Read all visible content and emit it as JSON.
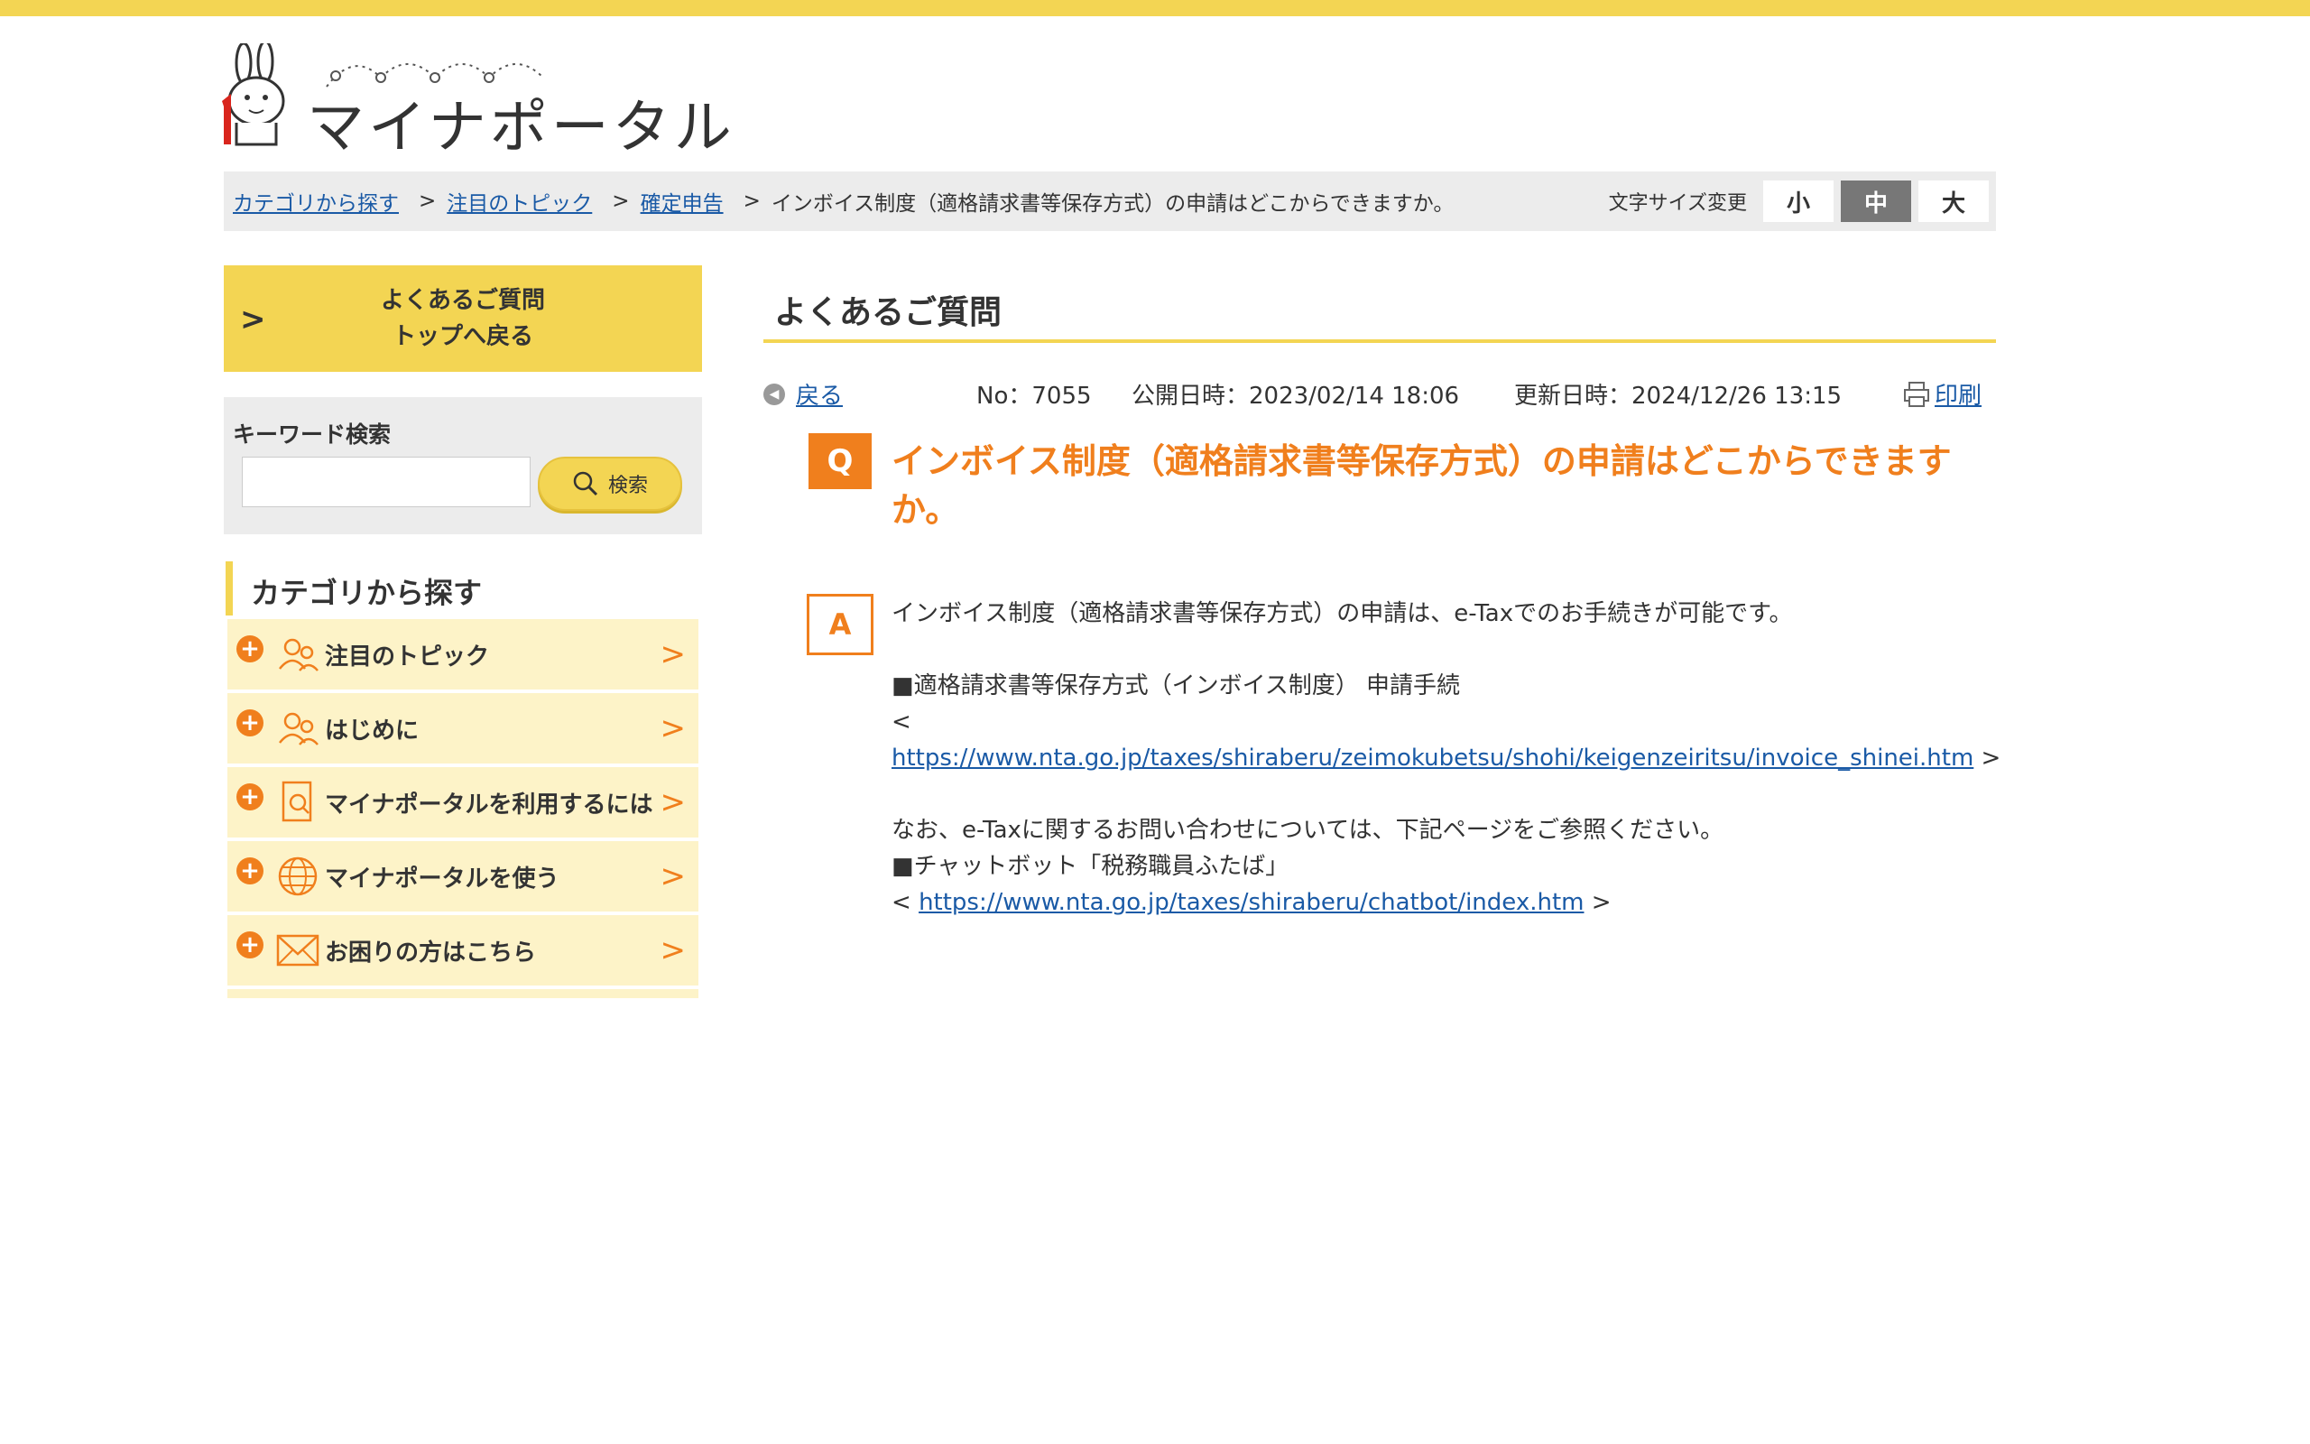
{
  "header": {
    "logo_text": "マイナポータル"
  },
  "breadcrumb": {
    "items": [
      "カテゴリから探す",
      "注目のトピック",
      "確定申告"
    ],
    "separator": ">",
    "current": "インボイス制度（適格請求書等保存方式）の申請はどこからできますか。"
  },
  "font_size": {
    "label": "文字サイズ変更",
    "options": [
      "小",
      "中",
      "大"
    ],
    "selected": "中"
  },
  "sidebar": {
    "faq_top_line1": "よくあるご質問",
    "faq_top_line2": "トップへ戻る",
    "faq_top_chevron": ">",
    "search_label": "キーワード検索",
    "search_value": "",
    "search_button": "検索",
    "category_heading": "カテゴリから探す",
    "categories": [
      {
        "label": "注目のトピック",
        "icon": "people-icon"
      },
      {
        "label": "はじめに",
        "icon": "people-icon"
      },
      {
        "label": "マイナポータルを利用するには",
        "icon": "document-search-icon"
      },
      {
        "label": "マイナポータルを使う",
        "icon": "globe-icon"
      },
      {
        "label": "お困りの方はこちら",
        "icon": "mail-icon"
      }
    ],
    "plus_glyph": "+",
    "arrow_glyph": ">"
  },
  "main": {
    "title": "よくあるご質問",
    "back_label": "戻る",
    "number": "No：7055",
    "published": "公開日時：2023/02/14 18:06",
    "updated": "更新日時：2024/12/26 13:15",
    "print_label": "印刷",
    "q_badge": "Q",
    "question": "インボイス制度（適格請求書等保存方式）の申請はどこからできますか。",
    "a_badge": "A",
    "answer": {
      "line1": "インボイス制度（適格請求書等保存方式）の申請は、e-Taxでのお手続きが可能です。",
      "line2": "■適格請求書等保存方式（インボイス制度） 申請手続",
      "line3": "<",
      "link1": "https://www.nta.go.jp/taxes/shiraberu/zeimokubetsu/shohi/keigenzeiritsu/invoice_shinei.htm",
      "link1_suffix": " >",
      "line4": "なお、e-Taxに関するお問い合わせについては、下記ページをご参照ください。",
      "line5": "■チャットボット「税務職員ふたば」",
      "link2_prefix": "< ",
      "link2": "https://www.nta.go.jp/taxes/shiraberu/chatbot/index.htm",
      "link2_suffix": " >"
    }
  },
  "colors": {
    "accent_yellow": "#f3d553",
    "accent_orange": "#f07f1d",
    "link_blue": "#1a5aa6",
    "category_bg": "#fdf3c8"
  }
}
